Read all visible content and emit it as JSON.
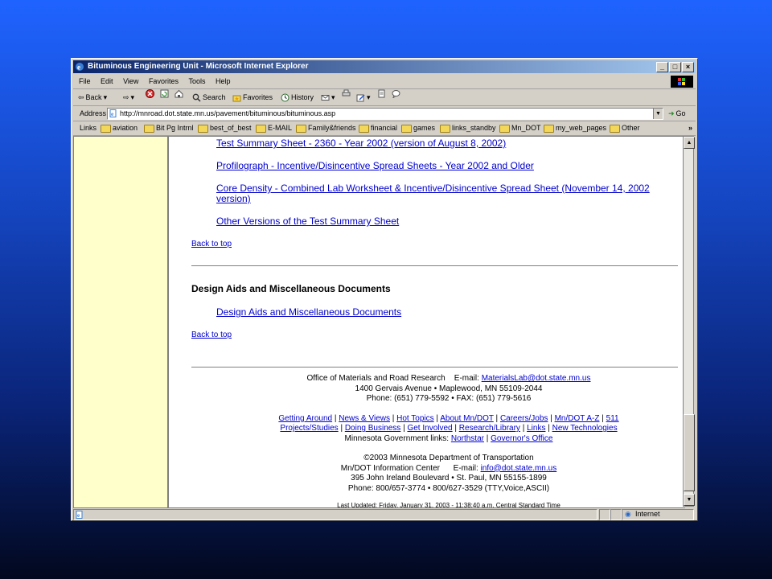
{
  "window": {
    "title": "Bituminous Engineering Unit - Microsoft Internet Explorer",
    "buttons": [
      "_",
      "□",
      "×"
    ]
  },
  "menu": [
    "File",
    "Edit",
    "View",
    "Favorites",
    "Tools",
    "Help"
  ],
  "toolbar": {
    "back": "Back",
    "search": "Search",
    "favorites": "Favorites",
    "history": "History"
  },
  "address": {
    "label": "Address",
    "url": "http://mnroad.dot.state.mn.us/pavement/bituminous/bituminous.asp",
    "go": "Go"
  },
  "links_bar": {
    "label": "Links",
    "items": [
      "aviation",
      "Bit Pg Intrnl",
      "best_of_best",
      "E-MAIL",
      "Family&friends",
      "financial",
      "games",
      "links_standby",
      "Mn_DOT",
      "my_web_pages",
      "Other"
    ],
    "more": "»"
  },
  "page": {
    "links_top": [
      "Test Summary Sheet - 2360 - Year 2002 (version of August 8, 2002)",
      "Profilograph - Incentive/Disincentive Spread Sheets - Year 2002 and Older",
      "Core Density - Combined Lab Worksheet & Incentive/Disincentive Spread Sheet (November 14, 2002",
      "version)",
      "Other Versions of the Test Summary Sheet"
    ],
    "back_to_top": "Back to top",
    "section_heading": "Design Aids and Miscellaneous Documents",
    "section_link": "Design Aids and Miscellaneous Documents",
    "footer": {
      "office": "Office of Materials and Road Research",
      "email_label": "E-mail:",
      "email": "MaterialsLab@dot.state.mn.us",
      "address": "1400 Gervais Avenue • Maplewood, MN 55109-2044",
      "phone": "Phone: (651) 779-5592 • FAX: (651) 779-5616",
      "nav1": [
        "Getting Around",
        "News & Views",
        "Hot Topics",
        "About Mn/DOT",
        "Careers/Jobs",
        "Mn/DOT A-Z",
        "511"
      ],
      "nav2": [
        "Projects/Studies",
        "Doing Business",
        "Get Involved",
        "Research/Library",
        "Links",
        "New Technologies"
      ],
      "gov_label": "Minnesota Government links:",
      "gov_links": [
        "Northstar",
        "Governor's Office"
      ],
      "copyright": "©2003 Minnesota Department of Transportation",
      "info_center": "Mn/DOT Information Center",
      "info_email_label": "E-mail:",
      "info_email": "info@dot.state.mn.us",
      "info_address": "395 John Ireland Boulevard • St. Paul, MN 55155-1899",
      "info_phone": "Phone: 800/657-3774 • 800/627-3529 (TTY,Voice,ASCII)",
      "last_updated": "Last Updated: Friday, January 31, 2003 - 11:38:40 a.m. Central Standard Time"
    }
  },
  "status": {
    "zone": "Internet"
  },
  "colors": {
    "link": "#0000cc",
    "left_column": "#ffffcc",
    "titlebar_start": "#0a246a",
    "titlebar_end": "#a6caf0"
  }
}
